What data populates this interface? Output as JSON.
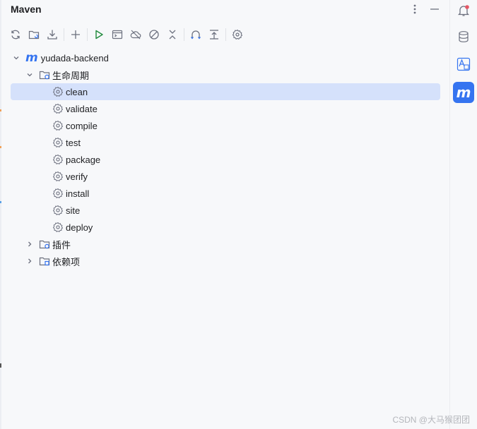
{
  "app": {
    "title": "Maven"
  },
  "tree": {
    "root": {
      "label": "yudada-backend"
    },
    "lifecycle": {
      "label": "生命周期",
      "items": [
        {
          "label": "clean"
        },
        {
          "label": "validate"
        },
        {
          "label": "compile"
        },
        {
          "label": "test"
        },
        {
          "label": "package"
        },
        {
          "label": "verify"
        },
        {
          "label": "install"
        },
        {
          "label": "site"
        },
        {
          "label": "deploy"
        }
      ]
    },
    "plugins": {
      "label": "插件"
    },
    "dependencies": {
      "label": "依赖项"
    }
  },
  "selected_item": "clean",
  "watermark": "CSDN @大马猴团团",
  "colors": {
    "accent": "#3574f0",
    "selection": "#d5e1fb",
    "run_green": "#208a3c",
    "notification": "#e55765"
  }
}
